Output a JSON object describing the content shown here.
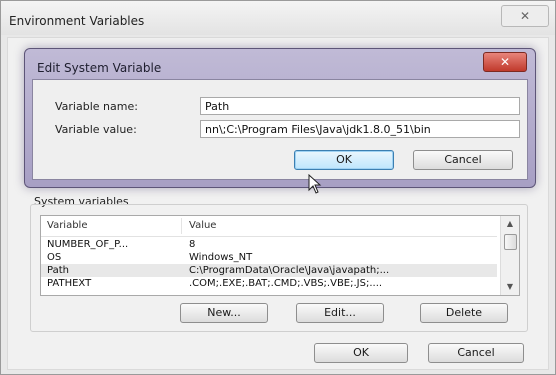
{
  "outer_window": {
    "title": "Environment Variables",
    "close_glyph": "✕"
  },
  "edit_dialog": {
    "title": "Edit System Variable",
    "close_glyph": "✕",
    "variable_name_label": "Variable name:",
    "variable_name_value": "Path",
    "variable_value_label": "Variable value:",
    "variable_value_value": "nn\\;C:\\Program Files\\Java\\jdk1.8.0_51\\bin",
    "ok_label": "OK",
    "cancel_label": "Cancel"
  },
  "system_variables": {
    "group_label": "System variables",
    "columns": {
      "variable": "Variable",
      "value": "Value"
    },
    "rows": [
      {
        "variable": "NUMBER_OF_P...",
        "value": "8"
      },
      {
        "variable": "OS",
        "value": "Windows_NT"
      },
      {
        "variable": "Path",
        "value": "C:\\ProgramData\\Oracle\\Java\\javapath;..."
      },
      {
        "variable": "PATHEXT",
        "value": ".COM;.EXE;.BAT;.CMD;.VBS;.VBE;.JS;...."
      }
    ],
    "new_label": "New...",
    "edit_label": "Edit...",
    "delete_label": "Delete"
  },
  "footer": {
    "ok_label": "OK",
    "cancel_label": "Cancel"
  },
  "icons": {
    "scroll_up": "▲",
    "scroll_down": "▼"
  },
  "colors": {
    "dialog_frame": "#a79fc4",
    "close_button": "#c03a2c",
    "default_button": "#bee6fd"
  }
}
